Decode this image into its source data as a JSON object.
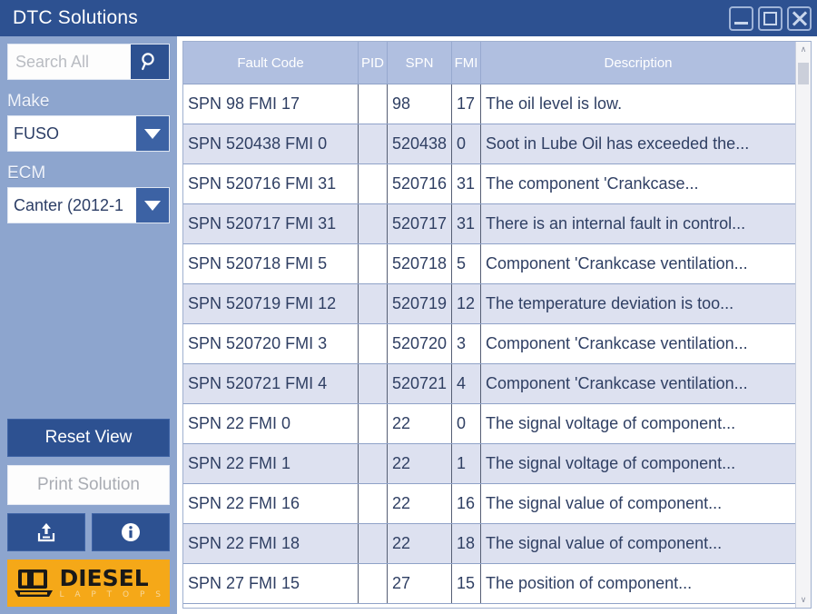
{
  "window": {
    "title": "DTC Solutions",
    "controls": [
      {
        "name": "minimize",
        "glyph": "minimize-icon"
      },
      {
        "name": "maximize",
        "glyph": "maximize-icon"
      },
      {
        "name": "close",
        "glyph": "close-icon"
      }
    ]
  },
  "colors": {
    "titlebar": "#2d5191",
    "sidebar": "#8da5ce",
    "accent": "#2d5191",
    "header_row": "#b0bfe0",
    "row_alt": "#dde1f0",
    "logo_bg": "#f5a818"
  },
  "sidebar": {
    "search": {
      "placeholder": "Search All",
      "value": "",
      "button_icon": "search-icon"
    },
    "make": {
      "label": "Make",
      "value": "FUSO"
    },
    "ecm": {
      "label": "ECM",
      "value": "Canter (2012-1"
    },
    "reset_label": "Reset View",
    "print_label": "Print Solution",
    "upload_icon": "upload-icon",
    "info_icon": "info-icon",
    "logo": {
      "main": "DIESEL",
      "sub": "L A P T O P S",
      "icon": "laptop-icon"
    }
  },
  "table": {
    "columns": [
      "Fault Code",
      "PID",
      "SPN",
      "FMI",
      "Description"
    ],
    "rows": [
      {
        "fault": "SPN 98 FMI 17",
        "pid": "",
        "spn": "98",
        "fmi": "17",
        "desc": "The oil level is low."
      },
      {
        "fault": "SPN 520438 FMI 0",
        "pid": "",
        "spn": "520438",
        "fmi": "0",
        "desc": "Soot in Lube Oil has exceeded the..."
      },
      {
        "fault": "SPN 520716 FMI 31",
        "pid": "",
        "spn": "520716",
        "fmi": "31",
        "desc": "The component 'Crankcase..."
      },
      {
        "fault": "SPN 520717 FMI 31",
        "pid": "",
        "spn": "520717",
        "fmi": "31",
        "desc": "There is an internal fault in control..."
      },
      {
        "fault": "SPN 520718 FMI 5",
        "pid": "",
        "spn": "520718",
        "fmi": "5",
        "desc": "Component 'Crankcase ventilation..."
      },
      {
        "fault": "SPN 520719 FMI 12",
        "pid": "",
        "spn": "520719",
        "fmi": "12",
        "desc": "The temperature deviation is too..."
      },
      {
        "fault": "SPN 520720 FMI 3",
        "pid": "",
        "spn": "520720",
        "fmi": "3",
        "desc": "Component 'Crankcase ventilation..."
      },
      {
        "fault": "SPN 520721 FMI 4",
        "pid": "",
        "spn": "520721",
        "fmi": "4",
        "desc": "Component 'Crankcase ventilation..."
      },
      {
        "fault": "SPN 22 FMI 0",
        "pid": "",
        "spn": "22",
        "fmi": "0",
        "desc": "The signal voltage of component..."
      },
      {
        "fault": "SPN 22 FMI 1",
        "pid": "",
        "spn": "22",
        "fmi": "1",
        "desc": "The signal voltage of component..."
      },
      {
        "fault": "SPN 22 FMI 16",
        "pid": "",
        "spn": "22",
        "fmi": "16",
        "desc": "The signal value of component..."
      },
      {
        "fault": "SPN 22 FMI 18",
        "pid": "",
        "spn": "22",
        "fmi": "18",
        "desc": "The signal value of component..."
      },
      {
        "fault": "SPN 27 FMI 15",
        "pid": "",
        "spn": "27",
        "fmi": "15",
        "desc": "The position of component..."
      }
    ]
  },
  "scrollbar": {
    "up_glyph": "∧",
    "down_glyph": "∨"
  }
}
